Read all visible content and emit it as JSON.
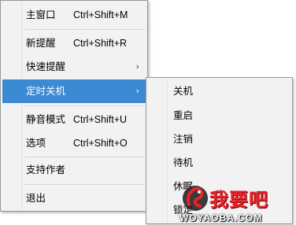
{
  "menu": {
    "items": [
      {
        "label": "主窗口",
        "shortcut": "Ctrl+Shift+M"
      },
      {
        "label": "新提醒",
        "shortcut": "Ctrl+Shift+R"
      },
      {
        "label": "快速提醒",
        "shortcut": ""
      },
      {
        "label": "定时关机",
        "shortcut": ""
      },
      {
        "label": "静音模式",
        "shortcut": "Ctrl+Shift+U"
      },
      {
        "label": "选项",
        "shortcut": "Ctrl+Shift+O"
      },
      {
        "label": "支持作者",
        "shortcut": ""
      },
      {
        "label": "退出",
        "shortcut": ""
      }
    ],
    "active_item": "定时关机",
    "arrow_glyph": "›"
  },
  "submenu": {
    "items": [
      {
        "label": "关机"
      },
      {
        "label": "重启"
      },
      {
        "label": "注销"
      },
      {
        "label": "待机"
      },
      {
        "label": "休眠"
      },
      {
        "label": "锁定"
      }
    ]
  },
  "watermark": {
    "text_cn": "我要吧",
    "text_en": "WOYAOBA.COM"
  },
  "colors": {
    "menu_bg": "#f2f2f2",
    "highlight": "#3c89d4",
    "border": "#979797",
    "watermark_red": "#e8222a"
  }
}
